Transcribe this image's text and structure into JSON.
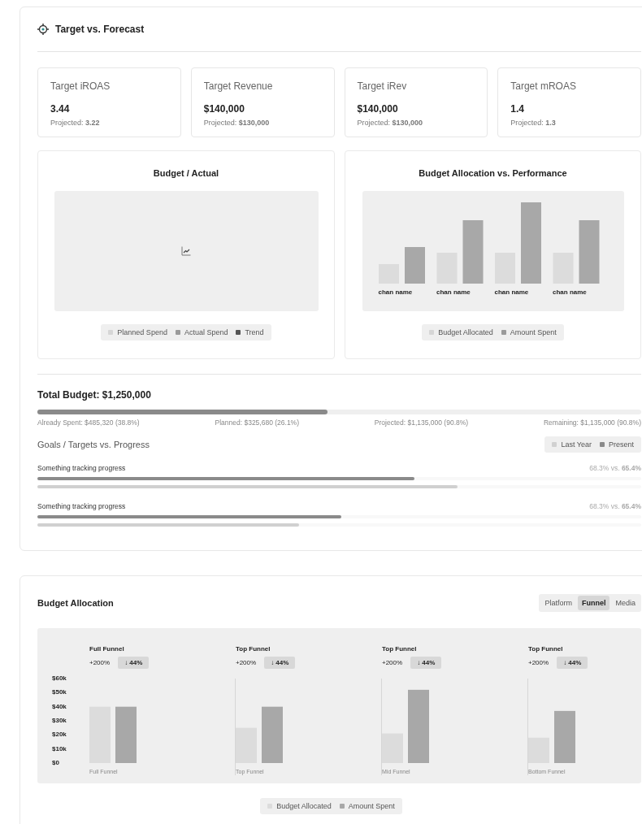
{
  "header": {
    "title": "Target vs. Forecast"
  },
  "kpis": [
    {
      "label": "Target iROAS",
      "value": "3.44",
      "projected": "Projected: **3.22**"
    },
    {
      "label": "Target Revenue",
      "value": "$140,000",
      "projected": "Projected: **$130,000**"
    },
    {
      "label": "Target iRev",
      "value": "$140,000",
      "projected": "Projected: **$130,000**"
    },
    {
      "label": "Target mROAS",
      "value": "1.4",
      "projected": "Projected: **1.3**"
    }
  ],
  "budget_actual": {
    "title": "Budget / Actual",
    "legend": [
      {
        "label": "Planned Spend",
        "color": "#d6d6d6"
      },
      {
        "label": "Actual Spend",
        "color": "#9a9a9a"
      },
      {
        "label": "Trend",
        "color": "#555555"
      }
    ]
  },
  "allocation_performance": {
    "title": "Budget Allocation vs. Performance",
    "channels": [
      "chan name",
      "chan name",
      "chan name",
      "chan name"
    ],
    "legend": [
      {
        "label": "Budget Allocated",
        "color": "#d6d6d6"
      },
      {
        "label": "Amount Spent",
        "color": "#9a9a9a"
      }
    ]
  },
  "total_budget": {
    "title": "Total Budget: $1,250,000",
    "level": 0.48,
    "stats": [
      "Already Spent: $485,320 (38.8%)",
      "Planned: $325,680 (26.1%)",
      "Projected: $1,135,000 (90.8%)",
      "Remaining: $1,135,000 (90.8%)"
    ]
  },
  "goals": {
    "title": "Goals / Targets vs. Progress",
    "legend": [
      {
        "label": "Last Year",
        "color": "#d0d0d0"
      },
      {
        "label": "Present",
        "color": "#8a8a8a"
      }
    ],
    "items": [
      {
        "label": "Something tracking progress",
        "comparison": "68.3% vs. **65.4%**",
        "bars": [
          {
            "kind": "present",
            "level": 0.625
          },
          {
            "kind": "last_year",
            "level": 0.696
          }
        ]
      },
      {
        "label": "Something tracking progress",
        "comparison": "68.3% vs. **65.4%**",
        "bars": [
          {
            "kind": "present",
            "level": 0.504
          },
          {
            "kind": "last_year",
            "level": 0.433
          }
        ]
      }
    ]
  },
  "budget_allocation": {
    "title": "Budget Allocation",
    "tabs": [
      {
        "label": "Platform",
        "selected": false
      },
      {
        "label": "Funnel",
        "selected": true
      },
      {
        "label": "Media",
        "selected": false
      }
    ],
    "panels": [
      {
        "title": "Full Funnel",
        "change": "+200%",
        "delta": "↓ 44%"
      },
      {
        "title": "Top Funnel",
        "change": "+200%",
        "delta": "↓ 44%"
      },
      {
        "title": "Top Funnel",
        "change": "+200%",
        "delta": "↓ 44%"
      },
      {
        "title": "Top Funnel",
        "change": "+200%",
        "delta": "↓ 44%"
      }
    ],
    "chart_data": {
      "type": "bar",
      "categories": [
        "Full Funnel",
        "Top Funnel",
        "Mid Funnel",
        "Bottom Funnel"
      ],
      "series": [
        {
          "name": "Budget Allocated",
          "color": "#dcdcdc",
          "values": [
            40000,
            25000,
            21000,
            18000
          ]
        },
        {
          "name": "Amount Spent",
          "color": "#a8a8a8",
          "values": [
            40000,
            40000,
            52000,
            37000
          ]
        }
      ],
      "stacked": false,
      "ylim": [
        0,
        60000
      ],
      "yticks": [
        {
          "value": 60000,
          "label": "$60k"
        },
        {
          "value": 50000,
          "label": "$50k"
        },
        {
          "value": 40000,
          "label": "$40k"
        },
        {
          "value": 30000,
          "label": "$30k"
        },
        {
          "value": 20000,
          "label": "$20k"
        },
        {
          "value": 10000,
          "label": "$10k"
        },
        {
          "value": 0,
          "label": "$0"
        }
      ]
    }
  }
}
